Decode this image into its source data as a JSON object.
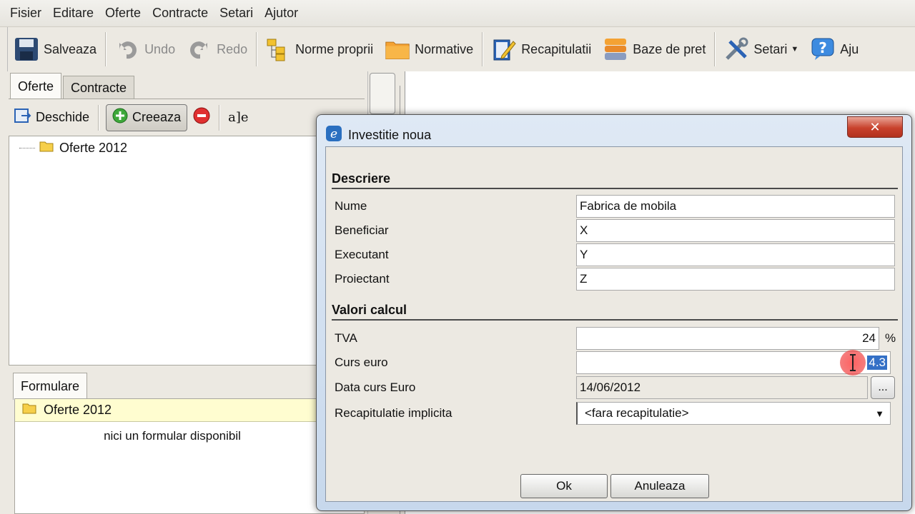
{
  "menu": [
    "Fisier",
    "Editare",
    "Oferte",
    "Contracte",
    "Setari",
    "Ajutor"
  ],
  "toolbar": {
    "save": "Salveaza",
    "undo": "Undo",
    "redo": "Redo",
    "norme": "Norme proprii",
    "normative": "Normative",
    "recapitulatii": "Recapitulatii",
    "baze": "Baze de pret",
    "setari": "Setari",
    "ajutor": "Aju"
  },
  "left": {
    "tabs": [
      "Oferte",
      "Contracte"
    ],
    "open": "Deschide",
    "create": "Creeaza",
    "rename": "a]e",
    "tree_item": "Oferte 2012",
    "forms_tab": "Formulare",
    "forms_row": "Oferte 2012",
    "forms_msg": "nici un formular disponibil"
  },
  "dialog": {
    "title": "Investitie noua",
    "section1": "Descriere",
    "section2": "Valori calcul",
    "fields": {
      "nume": {
        "label": "Nume",
        "value": "Fabrica de mobila"
      },
      "beneficiar": {
        "label": "Beneficiar",
        "value": "X"
      },
      "executant": {
        "label": "Executant",
        "value": "Y"
      },
      "proiectant": {
        "label": "Proiectant",
        "value": "Z"
      },
      "tva": {
        "label": "TVA",
        "value": "24",
        "unit": "%"
      },
      "curs": {
        "label": "Curs euro",
        "value": "4.3"
      },
      "data": {
        "label": "Data curs Euro",
        "value": "14/06/2012",
        "button": "..."
      },
      "recap": {
        "label": "Recapitulatie implicita",
        "value": "<fara recapitulatie>"
      }
    },
    "ok": "Ok",
    "cancel": "Anuleaza"
  },
  "colors": {
    "accent": "#3470c6",
    "close": "#c8412c"
  }
}
